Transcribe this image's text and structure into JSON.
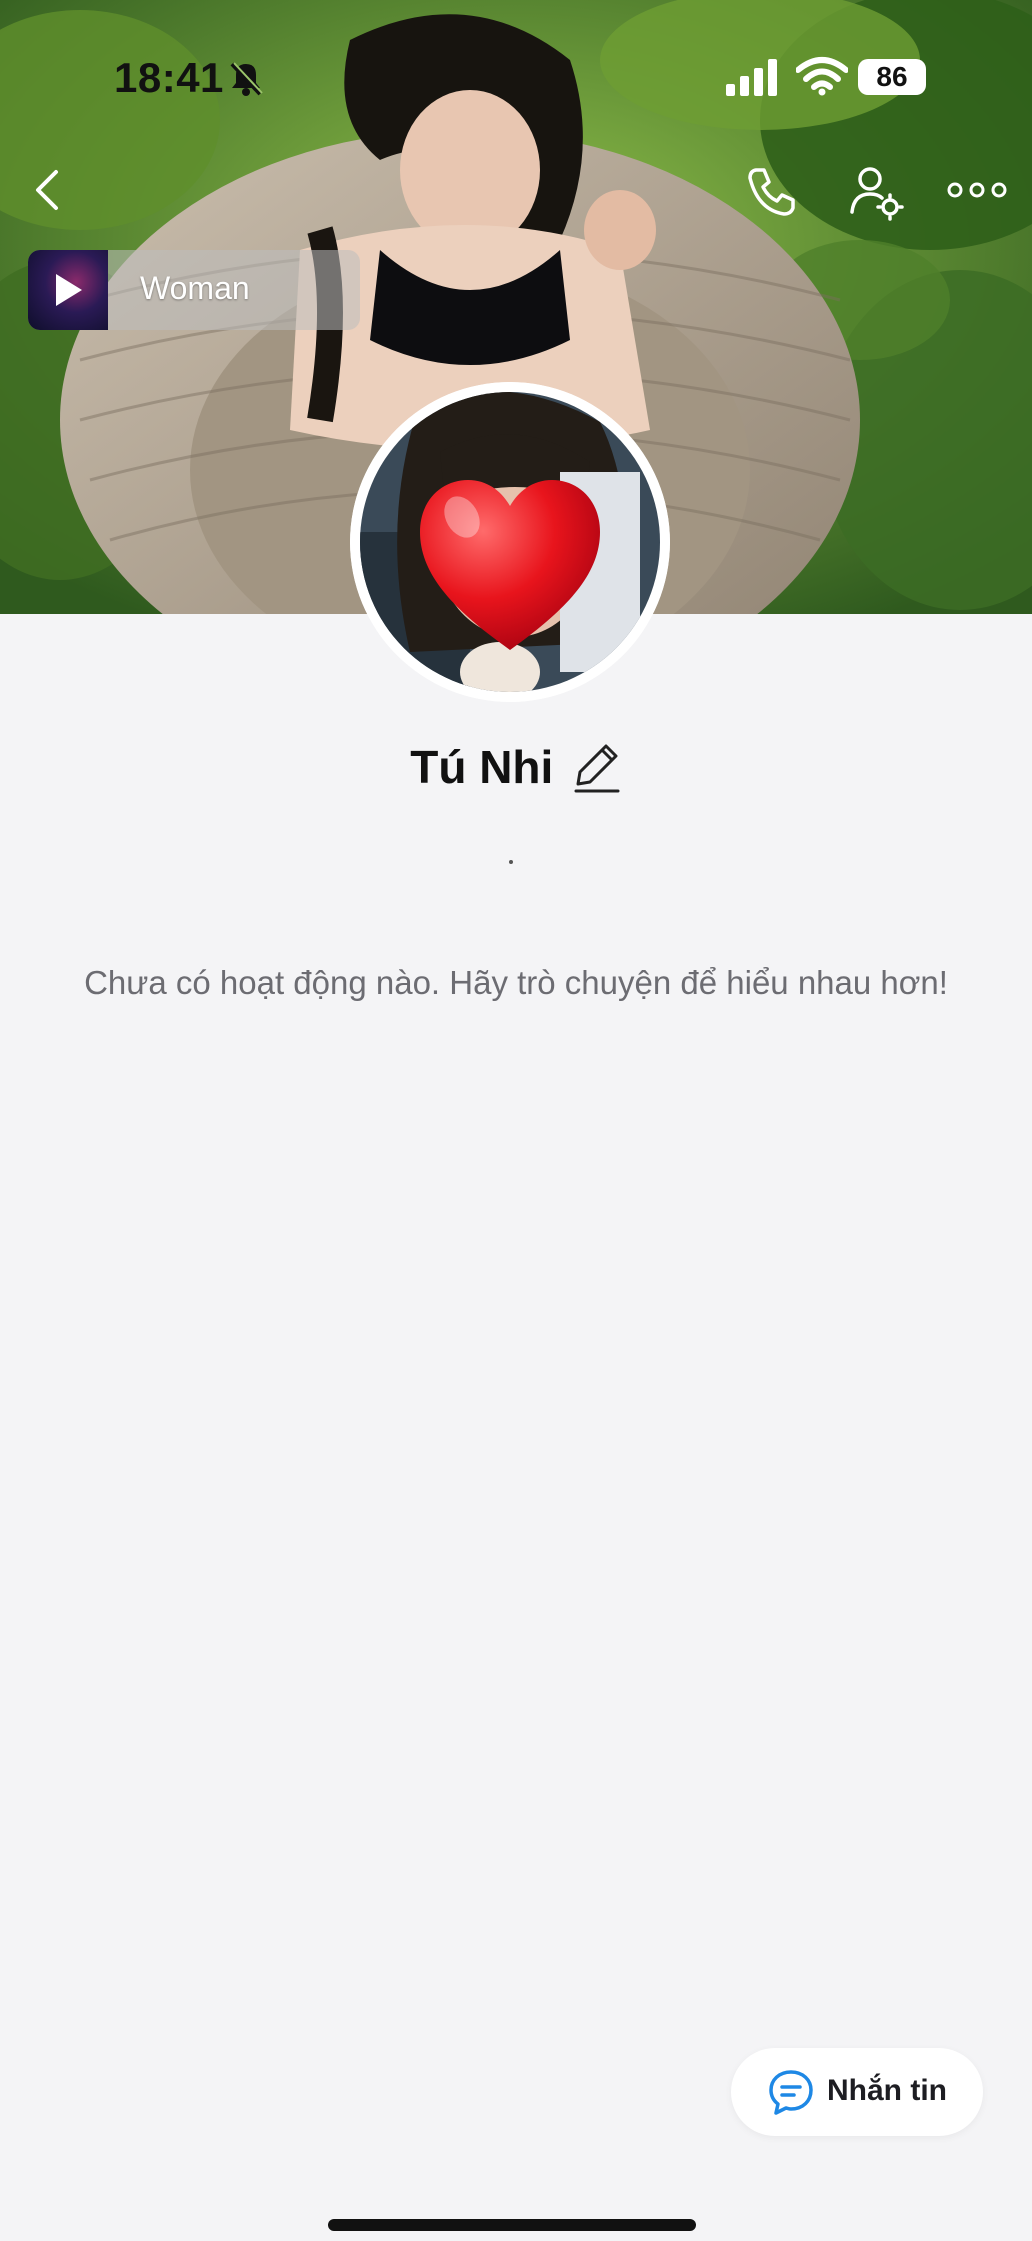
{
  "status_bar": {
    "time": "18:41",
    "battery": "86",
    "icons": [
      "bell-off-icon",
      "signal-icon",
      "wifi-icon",
      "battery-icon"
    ]
  },
  "header": {
    "icons": [
      "back-icon",
      "phone-icon",
      "user-settings-icon",
      "more-icon"
    ]
  },
  "music": {
    "title": "Woman",
    "icon": "play-icon"
  },
  "profile": {
    "name": "Tú Nhi",
    "bio": "·",
    "edit_icon": "pencil-icon",
    "avatar_overlay_icon": "heart-icon"
  },
  "activity": {
    "empty_message": "Chưa có hoạt động nào. Hãy trò chuyện để hiểu nhau hơn!"
  },
  "actions": {
    "message_label": "Nhắn tin",
    "message_icon": "chat-bubble-icon"
  },
  "colors": {
    "background": "#f4f4f6",
    "accent_blue": "#1e88e5",
    "heart_red": "#e8141c"
  }
}
